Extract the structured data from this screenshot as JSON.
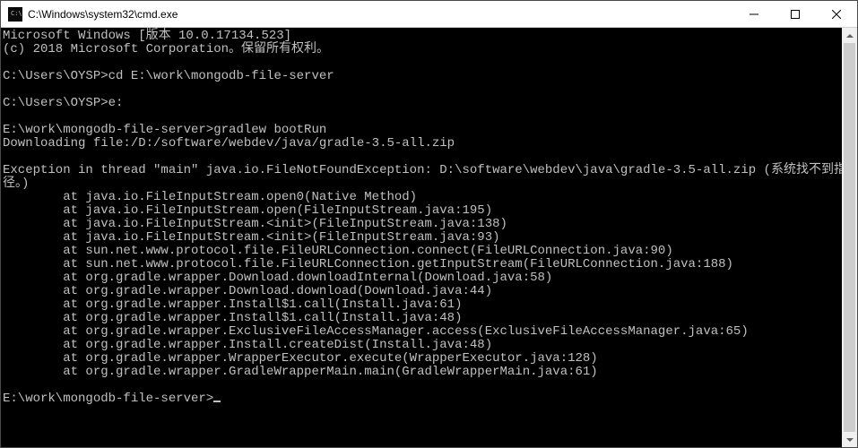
{
  "window": {
    "title": "C:\\Windows\\system32\\cmd.exe",
    "icon": "cmd-icon"
  },
  "controls": {
    "minimize": "minimize",
    "maximize": "maximize",
    "close": "close"
  },
  "terminal": {
    "lines": [
      "Microsoft Windows [版本 10.0.17134.523]",
      "(c) 2018 Microsoft Corporation。保留所有权利。",
      "",
      "C:\\Users\\OYSP>cd E:\\work\\mongodb-file-server",
      "",
      "C:\\Users\\OYSP>e:",
      "",
      "E:\\work\\mongodb-file-server>gradlew bootRun",
      "Downloading file:/D:/software/webdev/java/gradle-3.5-all.zip",
      "",
      "Exception in thread \"main\" java.io.FileNotFoundException: D:\\software\\webdev\\java\\gradle-3.5-all.zip (系统找不到指定的路",
      "径。)",
      "        at java.io.FileInputStream.open0(Native Method)",
      "        at java.io.FileInputStream.open(FileInputStream.java:195)",
      "        at java.io.FileInputStream.<init>(FileInputStream.java:138)",
      "        at java.io.FileInputStream.<init>(FileInputStream.java:93)",
      "        at sun.net.www.protocol.file.FileURLConnection.connect(FileURLConnection.java:90)",
      "        at sun.net.www.protocol.file.FileURLConnection.getInputStream(FileURLConnection.java:188)",
      "        at org.gradle.wrapper.Download.downloadInternal(Download.java:58)",
      "        at org.gradle.wrapper.Download.download(Download.java:44)",
      "        at org.gradle.wrapper.Install$1.call(Install.java:61)",
      "        at org.gradle.wrapper.Install$1.call(Install.java:48)",
      "        at org.gradle.wrapper.ExclusiveFileAccessManager.access(ExclusiveFileAccessManager.java:65)",
      "        at org.gradle.wrapper.Install.createDist(Install.java:48)",
      "        at org.gradle.wrapper.WrapperExecutor.execute(WrapperExecutor.java:128)",
      "        at org.gradle.wrapper.GradleWrapperMain.main(GradleWrapperMain.java:61)",
      ""
    ],
    "prompt": "E:\\work\\mongodb-file-server>"
  }
}
